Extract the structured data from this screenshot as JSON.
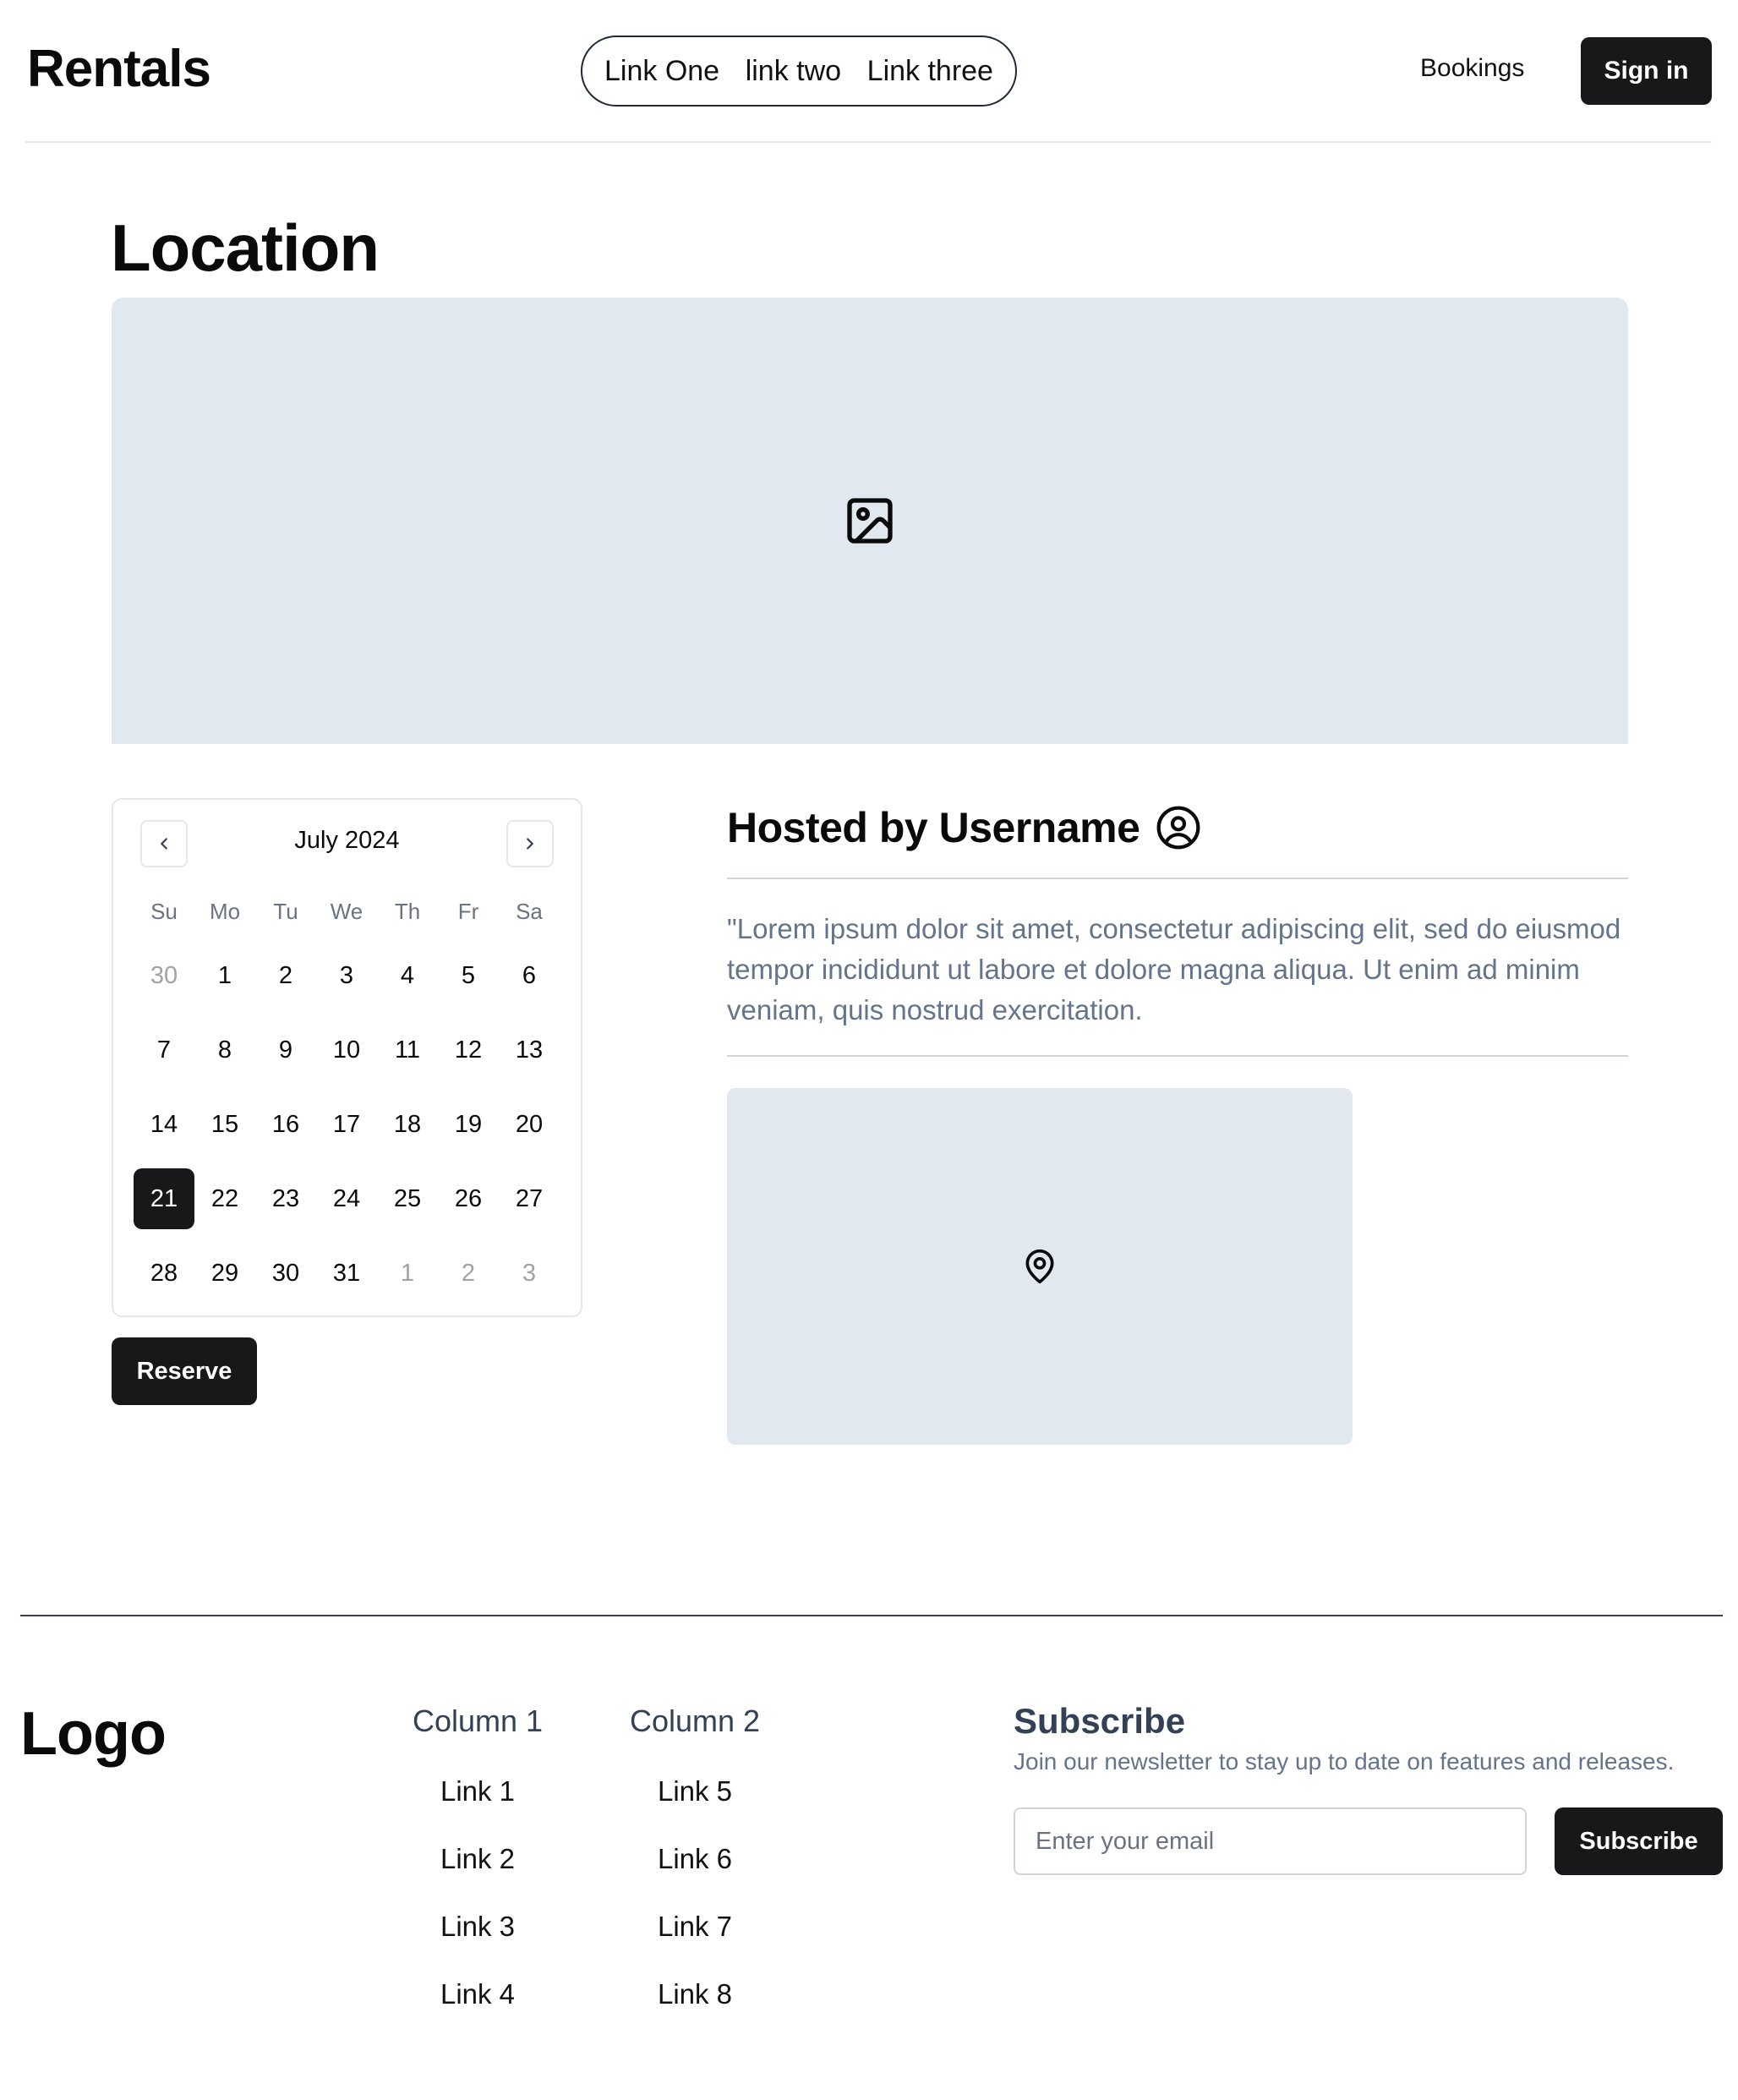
{
  "header": {
    "brand": "Rentals",
    "nav": [
      "Link One",
      "link two",
      "Link three"
    ],
    "bookings": "Bookings",
    "sign_in": "Sign in"
  },
  "main": {
    "title": "Location",
    "hero_icon": "image-icon",
    "calendar": {
      "month_label": "July 2024",
      "weekdays": [
        "Su",
        "Mo",
        "Tu",
        "We",
        "Th",
        "Fr",
        "Sa"
      ],
      "days": [
        {
          "d": "30",
          "muted": true
        },
        {
          "d": "1"
        },
        {
          "d": "2"
        },
        {
          "d": "3"
        },
        {
          "d": "4"
        },
        {
          "d": "5"
        },
        {
          "d": "6"
        },
        {
          "d": "7"
        },
        {
          "d": "8"
        },
        {
          "d": "9"
        },
        {
          "d": "10"
        },
        {
          "d": "11"
        },
        {
          "d": "12"
        },
        {
          "d": "13"
        },
        {
          "d": "14"
        },
        {
          "d": "15"
        },
        {
          "d": "16"
        },
        {
          "d": "17"
        },
        {
          "d": "18"
        },
        {
          "d": "19"
        },
        {
          "d": "20"
        },
        {
          "d": "21",
          "selected": true
        },
        {
          "d": "22"
        },
        {
          "d": "23"
        },
        {
          "d": "24"
        },
        {
          "d": "25"
        },
        {
          "d": "26"
        },
        {
          "d": "27"
        },
        {
          "d": "28"
        },
        {
          "d": "29"
        },
        {
          "d": "30"
        },
        {
          "d": "31"
        },
        {
          "d": "1",
          "muted": true
        },
        {
          "d": "2",
          "muted": true
        },
        {
          "d": "3",
          "muted": true
        }
      ],
      "prev_icon": "chevron-left-icon",
      "next_icon": "chevron-right-icon"
    },
    "reserve": "Reserve",
    "host": {
      "title": "Hosted by Username",
      "avatar_icon": "user-circle-icon",
      "quote": "\"Lorem ipsum dolor sit amet, consectetur adipiscing elit, sed do eiusmod tempor incididunt ut labore et dolore magna aliqua. Ut enim ad minim veniam, quis nostrud exercitation."
    },
    "map_icon": "map-pin-icon"
  },
  "footer": {
    "logo": "Logo",
    "columns": [
      {
        "title": "Column 1",
        "links": [
          "Link 1",
          "Link 2",
          "Link 3",
          "Link 4"
        ]
      },
      {
        "title": "Column 2",
        "links": [
          "Link 5",
          "Link 6",
          "Link 7",
          "Link 8"
        ]
      }
    ],
    "subscribe": {
      "title": "Subscribe",
      "description": "Join our newsletter to stay up to date on features and releases.",
      "email_placeholder": "Enter your email",
      "button": "Subscribe"
    }
  },
  "colors": {
    "placeholder_bg": "#e2e8f0",
    "button_bg": "#18181b",
    "muted_text": "#64748b"
  }
}
